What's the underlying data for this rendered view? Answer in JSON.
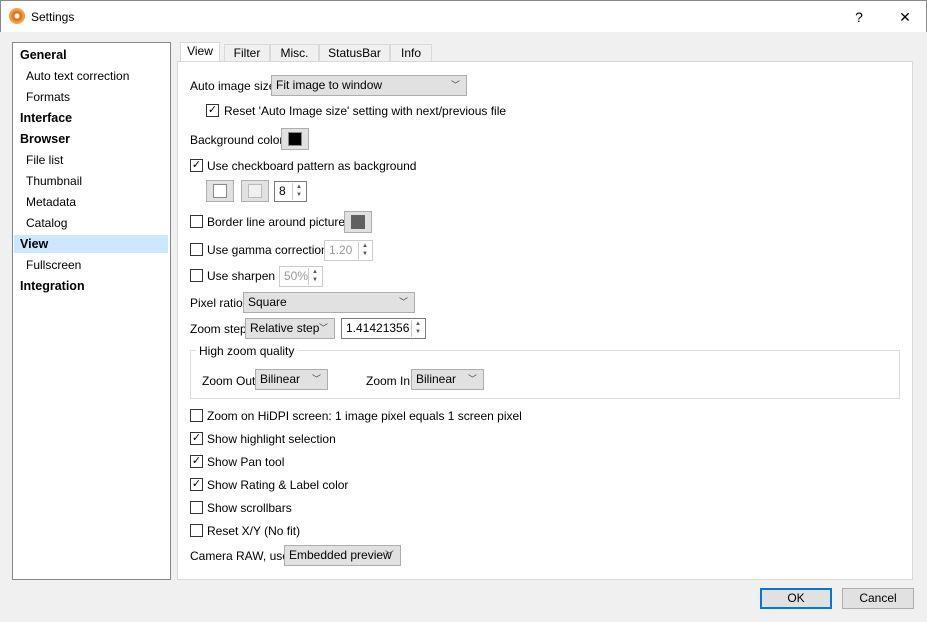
{
  "window": {
    "title": "Settings",
    "help": "?",
    "close": "✕"
  },
  "sidebar": {
    "items": [
      {
        "label": "General",
        "level": 0
      },
      {
        "label": "Auto text correction",
        "level": 1
      },
      {
        "label": "Formats",
        "level": 1
      },
      {
        "label": "Interface",
        "level": 0
      },
      {
        "label": "Browser",
        "level": 0
      },
      {
        "label": "File list",
        "level": 1
      },
      {
        "label": "Thumbnail",
        "level": 1
      },
      {
        "label": "Metadata",
        "level": 1
      },
      {
        "label": "Catalog",
        "level": 1
      },
      {
        "label": "View",
        "level": 0,
        "selected": true
      },
      {
        "label": "Fullscreen",
        "level": 1
      },
      {
        "label": "Integration",
        "level": 0
      }
    ]
  },
  "tabs": [
    "View",
    "Filter",
    "Misc.",
    "StatusBar",
    "Info"
  ],
  "view": {
    "auto_image_size_label": "Auto image size",
    "auto_image_size_value": "Fit image to window",
    "reset_auto_label": "Reset 'Auto Image size' setting with next/previous file",
    "reset_auto_checked": true,
    "bg_color_label": "Background color",
    "bg_color": "#000000",
    "checkboard_label": "Use checkboard pattern as background",
    "checkboard_checked": true,
    "checkboard_color1": "#ffffff",
    "checkboard_color2": "#f0f0f0",
    "checkboard_size": "8",
    "border_label": "Border line around picture",
    "border_checked": false,
    "border_color": "#606060",
    "gamma_label": "Use gamma correction",
    "gamma_checked": false,
    "gamma_value": "1.20",
    "sharpen_label": "Use sharpen",
    "sharpen_checked": false,
    "sharpen_value": "50%",
    "pixel_ratio_label": "Pixel ratio",
    "pixel_ratio_value": "Square",
    "zoom_step_label": "Zoom step",
    "zoom_step_mode": "Relative step",
    "zoom_step_value": "1.41421356",
    "hq_group_label": "High zoom quality",
    "zoom_out_label": "Zoom Out",
    "zoom_out_value": "Bilinear",
    "zoom_in_label": "Zoom In",
    "zoom_in_value": "Bilinear",
    "checks": [
      {
        "label": "Zoom on HiDPI screen: 1 image pixel equals 1 screen pixel",
        "checked": false
      },
      {
        "label": "Show highlight selection",
        "checked": true
      },
      {
        "label": "Show Pan tool",
        "checked": true
      },
      {
        "label": "Show Rating & Label color",
        "checked": true
      },
      {
        "label": "Show scrollbars",
        "checked": false
      },
      {
        "label": "Reset X/Y (No fit)",
        "checked": false
      }
    ],
    "camera_raw_label": "Camera RAW, use",
    "camera_raw_value": "Embedded preview"
  },
  "buttons": {
    "ok": "OK",
    "cancel": "Cancel"
  }
}
